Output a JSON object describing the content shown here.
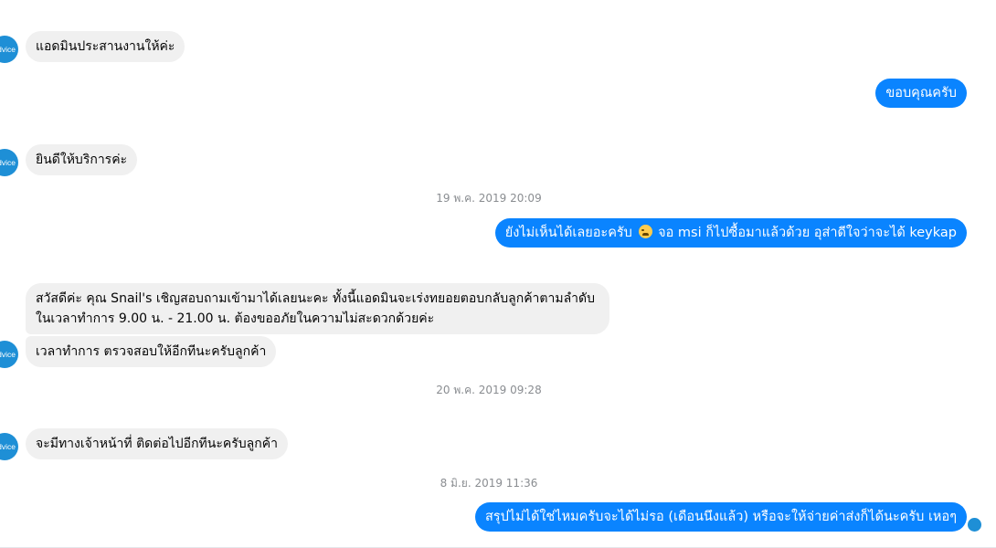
{
  "avatar_text": "dvice",
  "messages": {
    "m1": "แอดมินประสานงานให้ค่ะ",
    "m2": "ขอบคุณครับ",
    "m3": "ยินดีให้บริการค่ะ",
    "ts1": "19 พ.ค. 2019 20:09",
    "m4_before": "ยังไม่เห็นได้เลยอะครับ",
    "m4_emoji": "crying-face-emoji",
    "m4_after": "จอ msi ก็ไปซื้อมาแล้วด้วย อุส่าดีใจว่าจะได้ keykap",
    "m5": "สวัสดีค่ะ คุณ Snail's  เชิญสอบถามเข้ามาได้เลยนะคะ ทั้งนี้แอดมินจะเร่งทยอยตอบกลับลูกค้าตามลำดับในเวลาทำการ 9.00 น. - 21.00 น. ต้องขออภัยในความไม่สะดวกด้วยค่ะ",
    "m6": "เวลาทำการ ตรวจสอบให้อีกทีนะครับลูกค้า",
    "ts2": "20 พ.ค. 2019 09:28",
    "m7": "จะมีทางเจ้าหน้าที่ ติดต่อไปอีกทีนะครับลูกค้า",
    "ts3": "8 มิ.ย. 2019 11:36",
    "m8": "สรุปไม่ได้ใช่ไหมครับจะได้ไม่รอ (เดือนนึงแล้ว) หรือจะให้จ่ายค่าส่งก็ได้นะครับ เหอๆ"
  },
  "colors": {
    "incoming_bubble": "#f0f0f0",
    "outgoing_bubble": "#0a84ff",
    "avatar": "#1e8fd6",
    "timestamp": "#8a8d91"
  }
}
